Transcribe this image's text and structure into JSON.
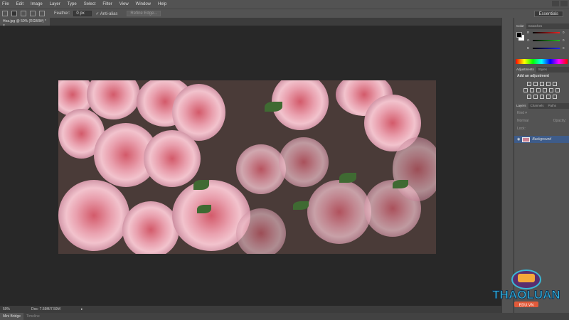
{
  "menu": [
    "File",
    "Edit",
    "Image",
    "Layer",
    "Type",
    "Select",
    "Filter",
    "View",
    "Window",
    "Help"
  ],
  "options": {
    "feather_label": "Feather:",
    "feather_value": "0 px",
    "antialias": "Anti-alias",
    "refine": "Refine Edge..."
  },
  "workspace": "Essentials",
  "doc_tab": "Hoa.jpg @ 50% (RGB/8#) *",
  "color_panel": {
    "tabs": [
      "Color",
      "Swatches"
    ],
    "channels": [
      "R",
      "G",
      "B"
    ],
    "values": [
      "0",
      "0",
      "0"
    ]
  },
  "adjustments": {
    "tabs": [
      "Adjustments",
      "Styles"
    ],
    "heading": "Add an adjustment"
  },
  "layers": {
    "tabs": [
      "Layers",
      "Channels",
      "Paths"
    ],
    "kind": "Kind",
    "blend": "Normal",
    "opacity": "Opacity:",
    "lock": "Lock:",
    "layer_name": "Background"
  },
  "status": {
    "zoom": "50%",
    "doc": "Doc: 7.59M/7.59M"
  },
  "bottom_tabs": [
    "Mini Bridge",
    "Timeline"
  ],
  "watermark": {
    "text": "THAOLUAN",
    "sub": "EDU.VN"
  }
}
